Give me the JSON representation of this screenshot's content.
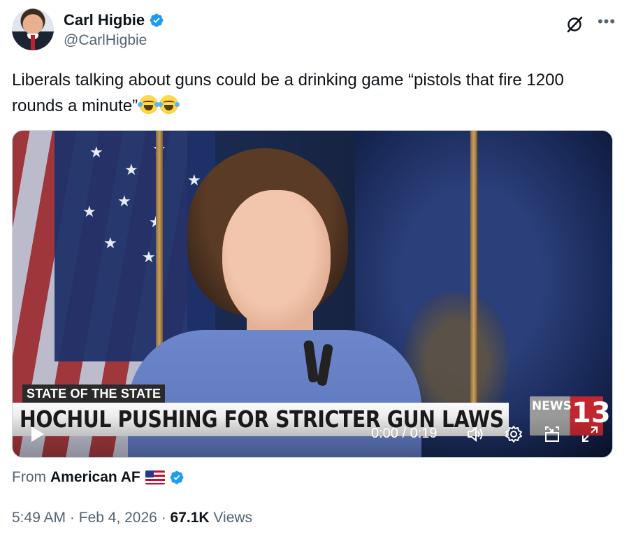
{
  "author": {
    "display_name": "Carl Higbie",
    "handle": "@CarlHigbie",
    "verified_color": "#1d9bf0"
  },
  "header_icons": {
    "grok": "grok-icon",
    "more": "more-dots-icon"
  },
  "tweet": {
    "text": "Liberals talking about guns could be a drinking game “pistols that fire 1200 rounds a minute”",
    "emoji": [
      "face-with-tears-of-joy",
      "face-with-tears-of-joy"
    ]
  },
  "video": {
    "lower_third_label": "STATE OF THE STATE",
    "headline": "HOCHUL PUSHING FOR STRICTER GUN LAWS",
    "station_logo_text": "NEWS",
    "station_logo_number": "13",
    "time_display": "0:00 / 0:19",
    "controls": [
      "play-icon",
      "volume-icon",
      "settings-icon",
      "pip-icon",
      "fullscreen-icon"
    ]
  },
  "source": {
    "prefix": "From",
    "name": "American AF",
    "flag": "us-flag-emoji"
  },
  "meta": {
    "time": "5:49 AM",
    "separator": "·",
    "date": "Feb 4, 2026",
    "views_count": "67.1K",
    "views_label": "Views"
  }
}
